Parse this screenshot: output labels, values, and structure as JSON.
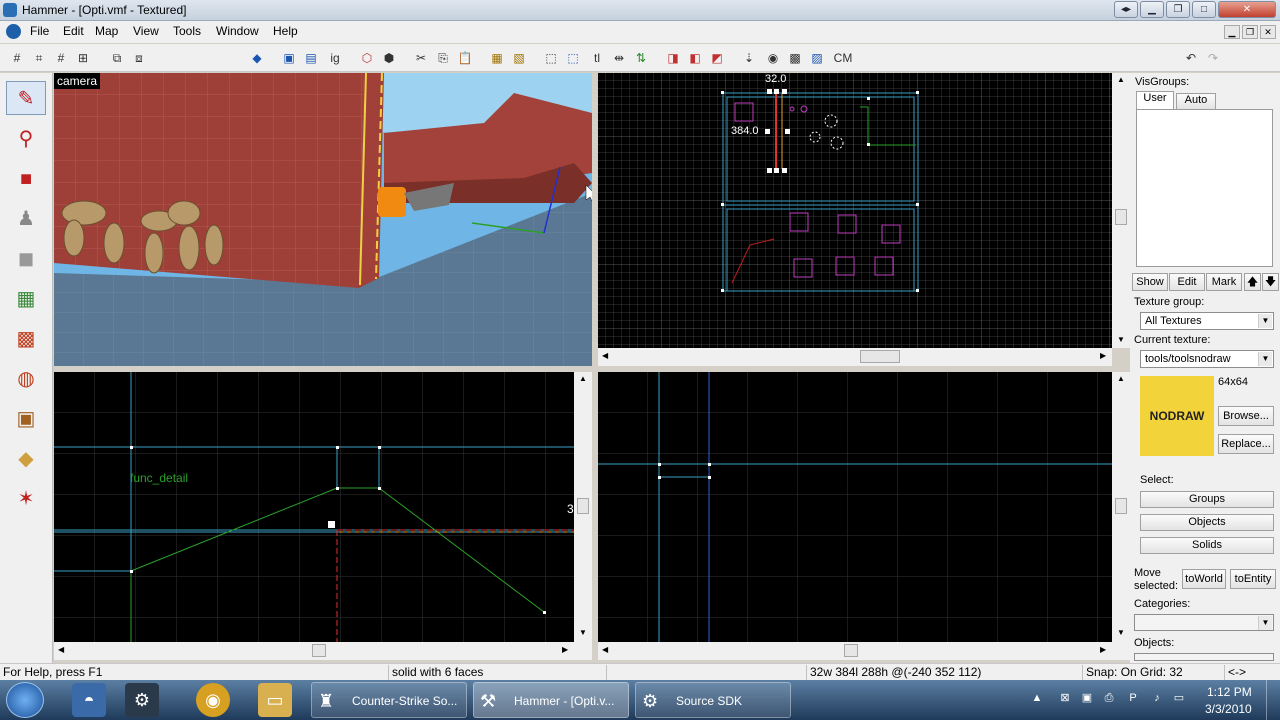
{
  "window": {
    "title": "Hammer - [Opti.vmf - Textured]"
  },
  "menu": [
    "File",
    "Edit",
    "Map",
    "View",
    "Tools",
    "Window",
    "Help"
  ],
  "viewports": {
    "camera_label": "camera",
    "top_right_labels": {
      "width": "32.0",
      "height": "384.0"
    },
    "side_label_entity": "func_detail",
    "side_edge_label": "3"
  },
  "right_panel": {
    "visgroups_label": "VisGroups:",
    "tab_user": "User",
    "tab_auto": "Auto",
    "show": "Show",
    "edit": "Edit",
    "mark": "Mark",
    "up_arrow": "🡅",
    "down_arrow": "🡇",
    "texture_group_label": "Texture group:",
    "texture_group_value": "All Textures",
    "current_texture_label": "Current texture:",
    "current_texture_value": "tools/toolsnodraw",
    "texture_size": "64x64",
    "texture_preview_text": "NODRAW",
    "browse": "Browse...",
    "replace": "Replace...",
    "select_label": "Select:",
    "groups": "Groups",
    "objects_btn": "Objects",
    "solids": "Solids",
    "move_selected_label_1": "Move",
    "move_selected_label_2": "selected:",
    "to_world": "toWorld",
    "to_entity": "toEntity",
    "categories_label": "Categories:",
    "objects_label": "Objects:"
  },
  "status": {
    "help": "For Help, press F1",
    "selection": "solid with 6 faces",
    "dimensions": "32w 384l 288h @(-240 352 112)",
    "snap": "Snap: On Grid: 32",
    "arrows": "<->"
  },
  "taskbar": {
    "tasks": [
      "Counter-Strike So...",
      "Hammer - [Opti.v...",
      "Source SDK"
    ],
    "time": "1:12 PM",
    "date": "3/3/2010"
  },
  "toolbar_text": {
    "cm": "CM",
    "ig": "ig",
    "tl": "tl"
  },
  "colors": {
    "grid": "#2a2a2a",
    "cyan": "#3ba0c8",
    "pink": "#c040c0",
    "green": "#2aa02a",
    "texture_yellow": "#f3d33a"
  }
}
